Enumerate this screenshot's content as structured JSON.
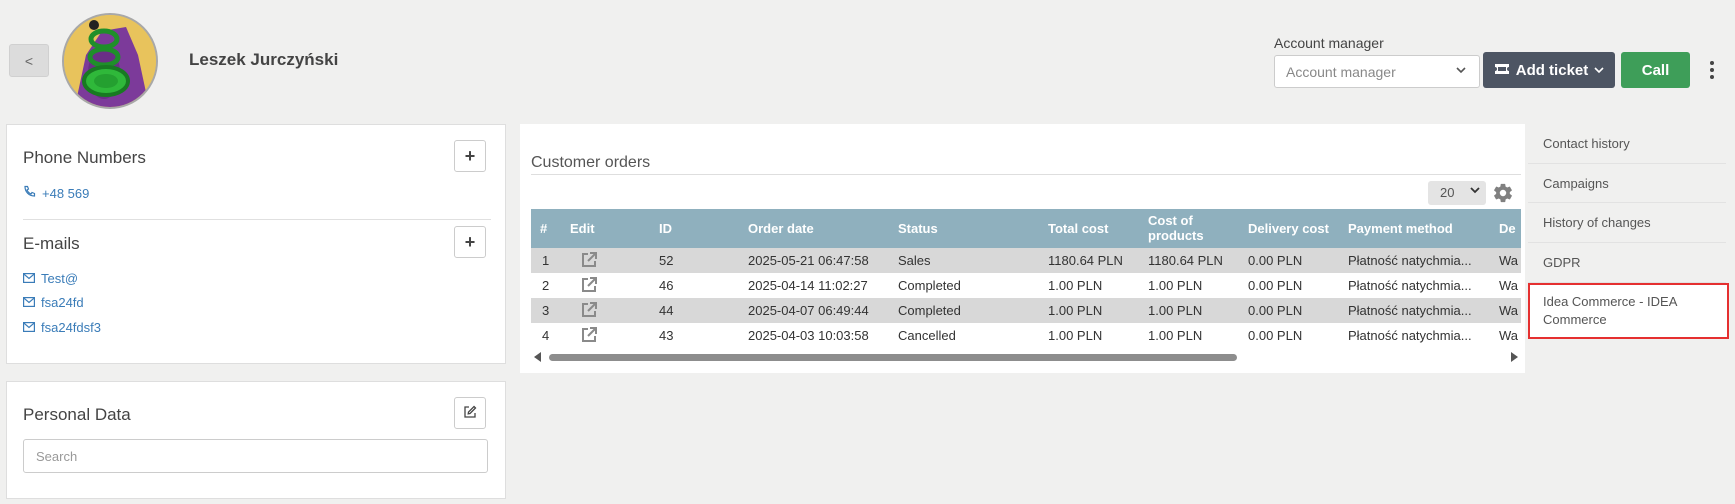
{
  "header": {
    "back_label": "<",
    "customer_name": "Leszek Jurczyński",
    "account_manager_label": "Account manager",
    "account_manager_placeholder": "Account manager",
    "add_ticket_label": "Add ticket",
    "call_label": "Call"
  },
  "phones": {
    "title": "Phone Numbers",
    "add_label": "+",
    "items": [
      "+48 569"
    ]
  },
  "emails": {
    "title": "E-mails",
    "add_label": "+",
    "items": [
      "Test@",
      "fsa24fd",
      "fsa24fdsf3"
    ]
  },
  "personal": {
    "title": "Personal Data",
    "search_placeholder": "Search"
  },
  "orders": {
    "title": "Customer orders",
    "page_size": "20",
    "columns": [
      "#",
      "Edit",
      "ID",
      "Order date",
      "Status",
      "Total cost",
      "Cost of products",
      "Delivery cost",
      "Payment method",
      "De"
    ],
    "rows": [
      {
        "num": "1",
        "id": "52",
        "date": "2025-05-21 06:47:58",
        "status": "Sales",
        "total": "1180.64 PLN",
        "products": "1180.64 PLN",
        "delivery": "0.00 PLN",
        "payment": "Płatność natychmia...",
        "de": "Wa"
      },
      {
        "num": "2",
        "id": "46",
        "date": "2025-04-14 11:02:27",
        "status": "Completed",
        "total": "1.00 PLN",
        "products": "1.00 PLN",
        "delivery": "0.00 PLN",
        "payment": "Płatność natychmia...",
        "de": "Wa"
      },
      {
        "num": "3",
        "id": "44",
        "date": "2025-04-07 06:49:44",
        "status": "Completed",
        "total": "1.00 PLN",
        "products": "1.00 PLN",
        "delivery": "0.00 PLN",
        "payment": "Płatność natychmia...",
        "de": "Wa"
      },
      {
        "num": "4",
        "id": "43",
        "date": "2025-04-03 10:03:58",
        "status": "Cancelled",
        "total": "1.00 PLN",
        "products": "1.00 PLN",
        "delivery": "0.00 PLN",
        "payment": "Płatność natychmia...",
        "de": "Wa"
      }
    ]
  },
  "sidebar": {
    "items": [
      {
        "label": "Contact history"
      },
      {
        "label": "Campaigns"
      },
      {
        "label": "History of changes"
      },
      {
        "label": "GDPR"
      },
      {
        "label": "Idea Commerce - IDEA Commerce"
      }
    ]
  },
  "colors": {
    "table_header": "#8fb0be",
    "add_ticket": "#4d5563",
    "call": "#3e9e59",
    "link": "#3a7cb8",
    "highlight": "#e53030"
  }
}
